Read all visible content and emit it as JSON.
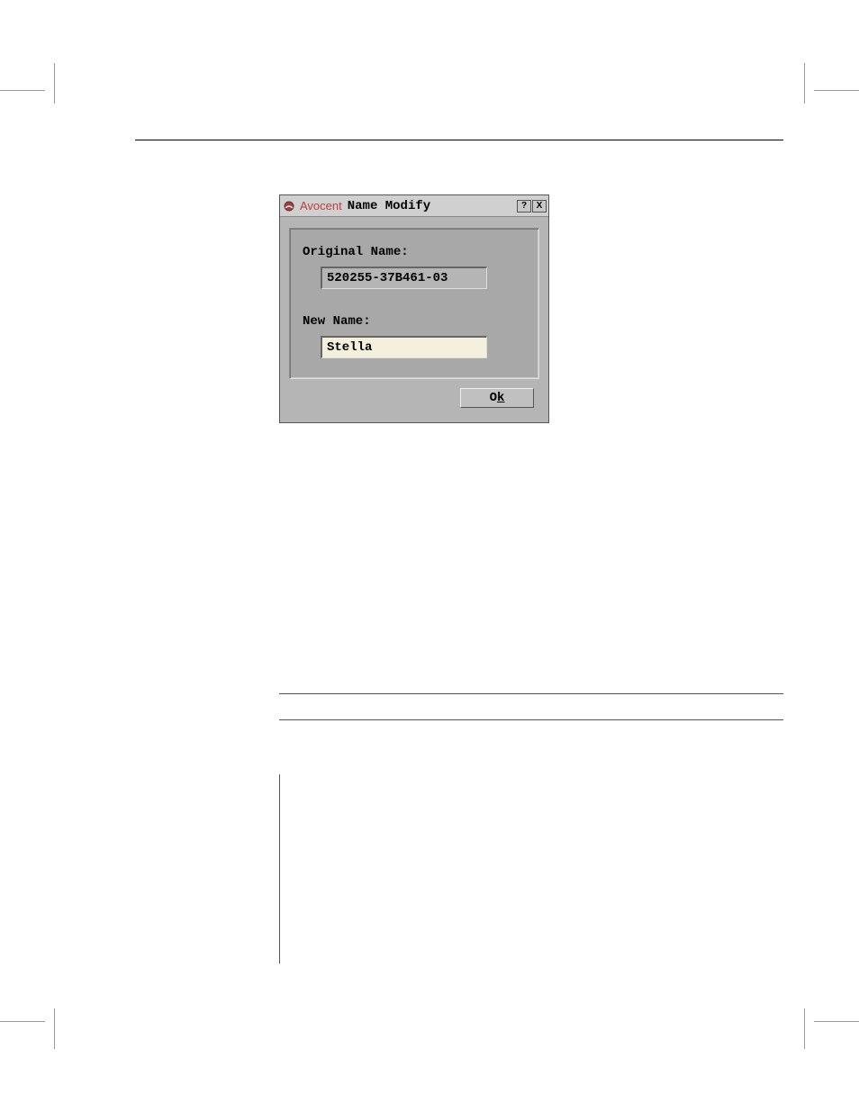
{
  "dialog": {
    "brand": "Avocent",
    "title": "Name Modify",
    "help_btn": "?",
    "close_btn": "X",
    "original_label": "Original Name:",
    "original_value": "520255-37B461-03",
    "new_label": "New Name:",
    "new_value": "Stella",
    "ok_prefix": "O",
    "ok_suffix": "k"
  }
}
